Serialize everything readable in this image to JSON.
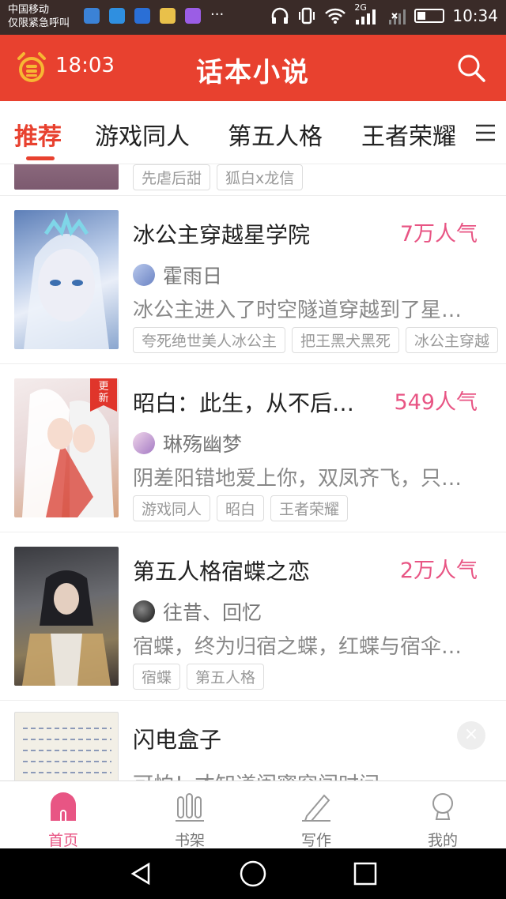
{
  "status_bar": {
    "carrier_line1": "中国移动",
    "carrier_line2": "仅限紧急呼叫",
    "more": "···",
    "network": "2G",
    "time": "10:34"
  },
  "app_bar": {
    "title": "话本小说",
    "timer": "18:03",
    "accent_color": "#e8412f"
  },
  "tabs": [
    {
      "label": "推荐",
      "active": true
    },
    {
      "label": "游戏同人",
      "active": false
    },
    {
      "label": "第五人格",
      "active": false
    },
    {
      "label": "王者荣耀",
      "active": false
    }
  ],
  "partial_tags": [
    "先虐后甜",
    "狐白x龙信"
  ],
  "books": [
    {
      "title": "冰公主穿越星学院",
      "popularity": "7万人气",
      "author": "霍雨日",
      "description": "冰公主进入了时空隧道穿越到了星…",
      "tags": [
        "夸死绝世美人冰公主",
        "把王黑犬黑死",
        "冰公主穿越"
      ]
    },
    {
      "title": "昭白：此生，从不后…",
      "popularity": "549人气",
      "author": "琳殇幽梦",
      "description": "阴差阳错地爱上你，双凤齐飞，只…",
      "tags": [
        "游戏同人",
        "昭白",
        "王者荣耀"
      ],
      "badge": "更新"
    },
    {
      "title": "第五人格宿蝶之恋",
      "popularity": "2万人气",
      "author": "往昔、回忆",
      "description": "宿蝶，终为归宿之蝶，红蝶与宿伞…",
      "tags": [
        "宿蝶",
        "第五人格"
      ]
    },
    {
      "title": "闪电盒子",
      "description_partial": "可怕！才知道闺蜜突闯时间"
    }
  ],
  "bottom_nav": [
    {
      "label": "首页",
      "active": true
    },
    {
      "label": "书架",
      "active": false
    },
    {
      "label": "写作",
      "active": false
    },
    {
      "label": "我的",
      "active": false
    }
  ],
  "colors": {
    "popularity": "#e85584",
    "active_nav": "#e85584"
  }
}
